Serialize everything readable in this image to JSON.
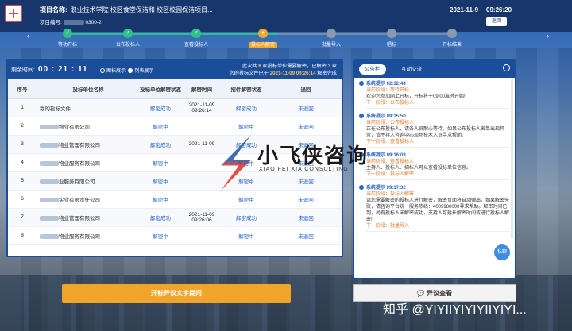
{
  "header": {
    "project_label": "项目名称:",
    "project_value": "职业技术学院 校区食堂保洁和 校区校园保洁项目...",
    "project_no_label": "项目编号:",
    "project_no_value": "0300-2",
    "date": "2021-11-9",
    "time": "09:26:20",
    "back_label": "返回"
  },
  "steps": [
    {
      "label": "等功开标",
      "state": "done"
    },
    {
      "label": "公布投标人",
      "state": "done"
    },
    {
      "label": "查看投标人",
      "state": "done"
    },
    {
      "label": "投标人解密",
      "state": "active"
    },
    {
      "label": "批量导入",
      "state": "todo"
    },
    {
      "label": "唱标",
      "state": "todo"
    },
    {
      "label": "开标结束",
      "state": "todo"
    }
  ],
  "panel": {
    "timer_label": "剩余时间:",
    "timer_value": "00 : 21 : 11",
    "view_grid": "图标展示",
    "view_list": "列表展示",
    "status_line1_a": "此次共",
    "status_line1_b": "8",
    "status_line1_c": "家投标单位需要解密，已解密",
    "status_line1_d": "3",
    "status_line1_e": "家",
    "status_line2_a": "您的投标文件已于",
    "status_line2_b": "2021-11-09 09:26:14",
    "status_line2_c": "解密完成"
  },
  "table": {
    "headers": [
      "序号",
      "投标单位名称",
      "投标单位解密状态",
      "解密时间",
      "招件解密状态",
      "退回"
    ],
    "rows": [
      {
        "no": "1",
        "name": "我的投标文件",
        "status": "解密成功",
        "time": "2021-11-09 09:26:14",
        "status2": "解密成功",
        "ret": "未退回"
      },
      {
        "no": "2",
        "name": "物业有限公司",
        "status": "解密中",
        "time": "",
        "status2": "解密中",
        "ret": "未退回"
      },
      {
        "no": "3",
        "name": "物业管理有限公司",
        "status": "解密成功",
        "time": "2021-11-09",
        "status2": "解密成功",
        "ret": "未退回"
      },
      {
        "no": "4",
        "name": "物业服务有限公司",
        "status": "解密中",
        "time": "",
        "status2": "解密中",
        "ret": "未退回"
      },
      {
        "no": "5",
        "name": "业服务有限公司",
        "status": "解密中",
        "time": "",
        "status2": "解密中",
        "ret": "未退回"
      },
      {
        "no": "6",
        "name": "实业有限责任公司",
        "status": "解密中",
        "time": "",
        "status2": "解密中",
        "ret": "未退回"
      },
      {
        "no": "7",
        "name": "物业管理有限公司",
        "status": "解密成功",
        "time": "2021-11-09 09:26:06",
        "status2": "解密成功",
        "ret": "未退回"
      },
      {
        "no": "8",
        "name": "物业服务有限公司",
        "status": "解密中",
        "time": "",
        "status2": "解密中",
        "ret": "未退回"
      }
    ]
  },
  "right": {
    "tab_notice": "公告栏",
    "tab_chat": "互动交流",
    "chat_btn": "私聊",
    "messages": [
      {
        "title": "系统提示 02:32:44",
        "stage": "当前阶段：等待开标",
        "body": "欢迎您参加网上开标，开标将于09:00准时开始!",
        "next": "下一阶段：公布投标人"
      },
      {
        "title": "系统提示 09:15:50",
        "stage": "当前阶段：公布投标人",
        "body": "正在公布投标人，请各人员耐心等待。如果公布投标人名单出现异常，请主持人咨询中心现场技术人员寻求帮助。",
        "next": "下一阶段：查看投标人"
      },
      {
        "title": "系统提示 09:16:09",
        "stage": "当前阶段：查看投标人",
        "body": "主持人、投标人、招标人可以查看投标单位信息。",
        "next": "下一阶段：投标人解密"
      },
      {
        "title": "系统提示 09:17:32",
        "stage": "当前阶段：投标人解密",
        "body": "请您需要解密的投标人进行解密，解密页面将自动弹出。如果解密失败，请咨询平台统一服务热线：4009980000寻求帮助。解密时间已到，尚有投标人未解密成功，支持人可延长解密时间或进行投标人解密!",
        "next": "下一阶段：批量导入"
      }
    ]
  },
  "buttons": {
    "objection_text": "开标异议文字提问",
    "objection_view": "异议查看"
  },
  "watermark": {
    "brand_cn": "小飞侠咨询",
    "brand_en": "XIAO FEI XIA CONSULTING",
    "zhihu": "知乎 @YIYIIYIYIYIIYIYI..."
  }
}
